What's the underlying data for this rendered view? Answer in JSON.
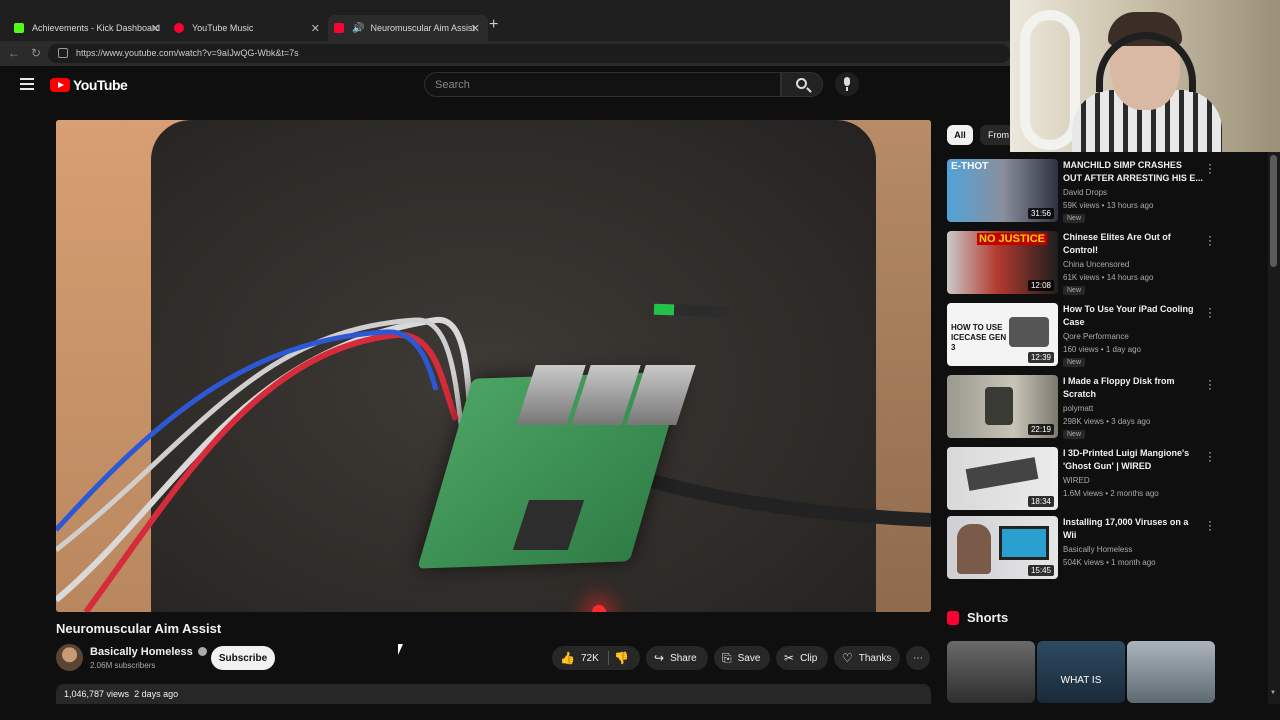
{
  "browser": {
    "tabs": [
      {
        "label": "Achievements - Kick Dashboard",
        "favicon_color": "#53fc18"
      },
      {
        "label": "YouTube Music",
        "favicon_color": "#ff0033"
      },
      {
        "label": "Neuromuscular Aim Assist",
        "favicon_color": "#ff0033"
      }
    ],
    "new_tab": "+",
    "url": "https://www.youtube.com/watch?v=9aIJwQG-Wbk&t=7s"
  },
  "header": {
    "logo_text": "YouTube",
    "search_placeholder": "Search"
  },
  "video": {
    "title": "Neuromuscular Aim Assist",
    "channel": "Basically Homeless",
    "subscribers": "2.06M subscribers",
    "subscribe_label": "Subscribe",
    "likes": "72K",
    "share_label": "Share",
    "save_label": "Save",
    "clip_label": "Clip",
    "thanks_label": "Thanks",
    "views": "1,046,787 views",
    "age": "2 days ago"
  },
  "sidebar": {
    "chips": [
      "All",
      "From"
    ],
    "recommendations": [
      {
        "title": "MANCHILD SIMP CRASHES OUT AFTER ARRESTING HIS E...",
        "channel": "David Drops",
        "meta": "59K views • 13 hours ago",
        "badge": "New",
        "duration": "31:56"
      },
      {
        "title": "Chinese Elites Are Out of Control!",
        "channel": "China Uncensored",
        "meta": "61K views • 14 hours ago",
        "badge": "New",
        "duration": "12:08"
      },
      {
        "title": "How To Use Your iPad Cooling Case",
        "channel": "Qore Performance",
        "meta": "160 views • 1 day ago",
        "badge": "New",
        "duration": "12:39"
      },
      {
        "title": "I Made a Floppy Disk from Scratch",
        "channel": "polymatt",
        "meta": "298K views • 3 days ago",
        "badge": "New",
        "duration": "22:19"
      },
      {
        "title": "I 3D-Printed Luigi Mangione's 'Ghost Gun' | WIRED",
        "channel": "WIRED",
        "meta": "1.6M views • 2 months ago",
        "badge": "",
        "duration": "18:34"
      },
      {
        "title": "Installing 17,000 Viruses on a Wii",
        "channel": "Basically Homeless",
        "meta": "504K views • 1 month ago",
        "badge": "",
        "duration": "15:45"
      }
    ],
    "thumb_overlays": [
      "E-THOT",
      "NO JUSTICE",
      "HOW TO USE ICECASE GEN 3"
    ],
    "shorts_title": "Shorts",
    "shorts": [
      {
        "label": ""
      },
      {
        "label": "WHAT IS"
      },
      {
        "label": ""
      }
    ]
  },
  "colors": {
    "background": "#0f0f0f",
    "accent": "#ff0000",
    "chip_active": "#f1f1f1"
  }
}
